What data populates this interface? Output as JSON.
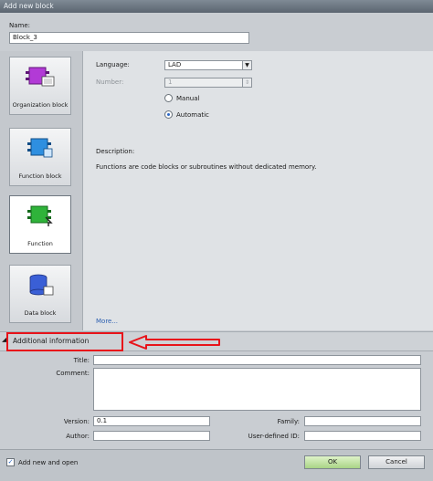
{
  "window": {
    "title": "Add new block"
  },
  "name": {
    "label": "Name:",
    "value": "Block_3"
  },
  "block_types": [
    {
      "label": "Organization block",
      "icon": "organization-block-icon",
      "selected": false
    },
    {
      "label": "Function block",
      "icon": "function-block-icon",
      "selected": false
    },
    {
      "label": "Function",
      "icon": "function-icon",
      "selected": true
    },
    {
      "label": "Data block",
      "icon": "data-block-icon",
      "selected": false
    }
  ],
  "settings": {
    "language_label": "Language:",
    "language_value": "LAD",
    "number_label": "Number:",
    "number_value": "1",
    "manual_label": "Manual",
    "automatic_label": "Automatic",
    "description_label": "Description:",
    "description_text": "Functions are code blocks or subroutines without dedicated memory.",
    "more_link": "More..."
  },
  "additional": {
    "title": "Additional information",
    "title_field_label": "Title:",
    "comment_label": "Comment:",
    "version_label": "Version:",
    "version_value": "0.1",
    "family_label": "Family:",
    "author_label": "Author:",
    "user_id_label": "User-defined ID:"
  },
  "footer": {
    "add_open_label": "Add new and open",
    "ok_label": "OK",
    "cancel_label": "Cancel"
  },
  "colors": {
    "highlight_red": "#e8131a",
    "ok_green": "#a9d486",
    "link_blue": "#2c5fb0"
  }
}
